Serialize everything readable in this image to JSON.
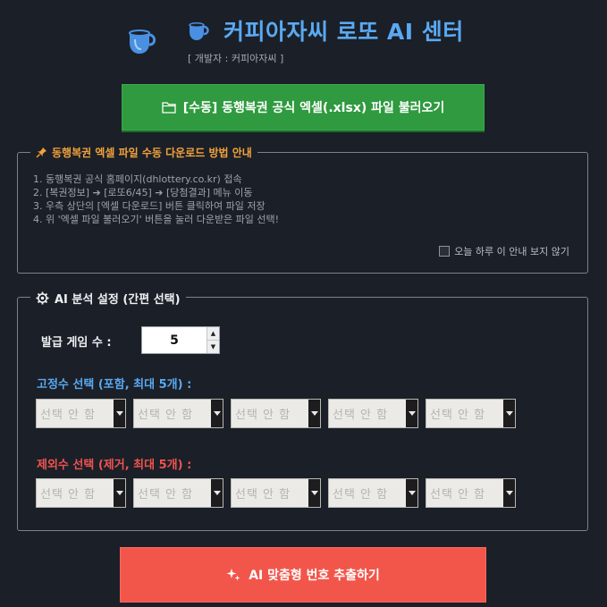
{
  "header": {
    "title": "커피아자씨 로또 AI 센터",
    "developer": "[ 개발자 : 커피아자씨 ]"
  },
  "load_button": {
    "label": "[수동] 동행복권 공식 엑셀(.xlsx) 파일 불러오기"
  },
  "guide": {
    "legend": "동행복권 엑셀 파일 수동 다운로드 방법 안내",
    "steps": [
      "1. 동행복권 공식 홈페이지(dhlottery.co.kr) 접속",
      "2. [복권정보] ➔ [로또6/45] ➔ [당첨결과] 메뉴 이동",
      "3. 우측 상단의 [엑셀 다운로드] 버튼 클릭하여 파일 저장",
      "4. 위 '엑셀 파일 불러오기' 버튼을 눌러 다운받은 파일 선택!"
    ],
    "hide_today_label": "오늘 하루 이 안내 보지 않기",
    "hide_today_checked": false
  },
  "settings": {
    "legend": "AI 분석 설정 (간편 선택)",
    "games_label": "발급 게임 수 :",
    "games_value": "5",
    "fixed_label": "고정수 선택 (포함, 최대 5개) :",
    "fixed_selects": [
      "선택 안 함",
      "선택 안 함",
      "선택 안 함",
      "선택 안 함",
      "선택 안 함"
    ],
    "excluded_label": "제외수 선택 (제거, 최대 5개) :",
    "excluded_selects": [
      "선택 안 함",
      "선택 안 함",
      "선택 안 함",
      "선택 안 함",
      "선택 안 함"
    ]
  },
  "extract_button": {
    "label": "AI 맞춤형 번호 추출하기"
  },
  "colors": {
    "background": "#1b1f27",
    "title_blue": "#5aa9f2",
    "load_green": "#2f9a3f",
    "guide_orange": "#f2a23c",
    "exclude_red": "#ef5350",
    "extract_red": "#f2564a"
  },
  "icons": {
    "logo": "coffee-cup-icon",
    "title": "coffee-cup-icon",
    "load": "folder-icon",
    "guide": "pushpin-icon",
    "settings": "gear-icon",
    "extract": "sparkle-icon"
  }
}
